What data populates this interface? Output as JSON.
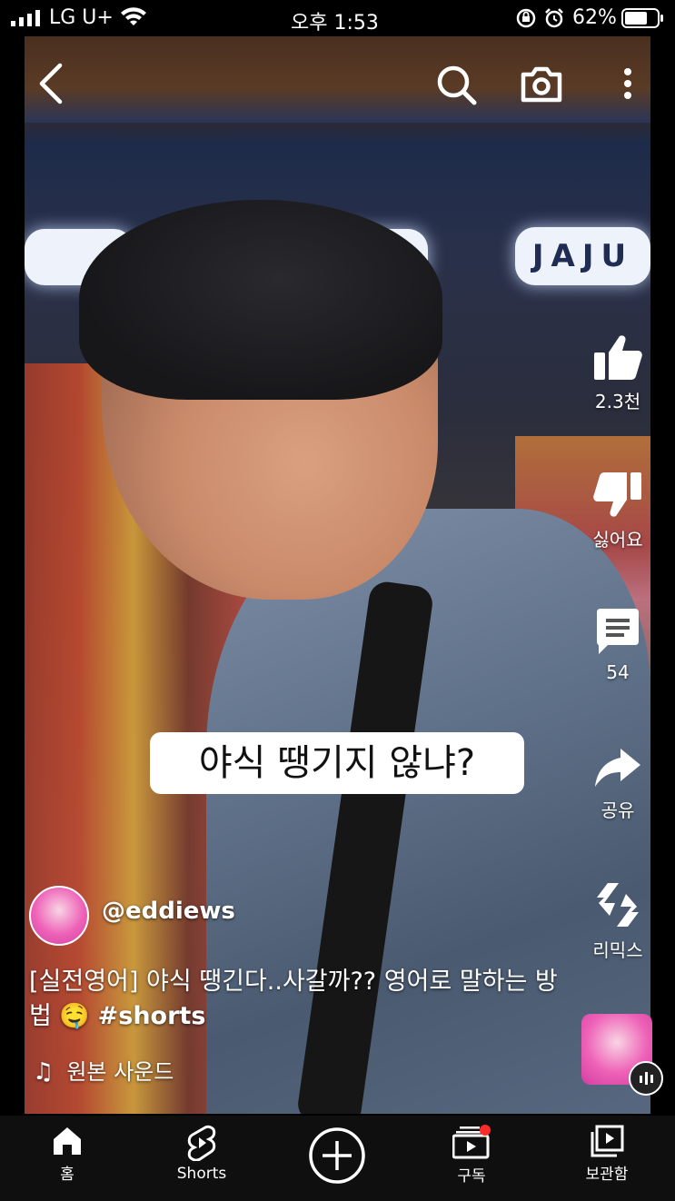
{
  "status_bar": {
    "carrier": "LG U+",
    "time": "오후 1:53",
    "battery": "62%",
    "icons": [
      "signal-icon",
      "wifi-icon",
      "rotation-lock-icon",
      "alarm-icon",
      "battery-icon"
    ]
  },
  "top_bar": {
    "back_icon": "back-arrow-icon",
    "search_icon": "search-icon",
    "camera_icon": "camera-icon",
    "more_icon": "more-vertical-icon"
  },
  "video": {
    "store_sign": "JAJU",
    "caption": "야식 땡기지 않냐?"
  },
  "actions": {
    "like_count": "2.3천",
    "dislike_label": "싫어요",
    "comment_count": "54",
    "share_label": "공유",
    "remix_label": "리믹스"
  },
  "channel": {
    "name": "@eddiews"
  },
  "video_title": {
    "text": "[실전영어] 야식 땡긴다..사갈까?? 영어로 말하는 방법 🤤",
    "hashtag": "#shorts"
  },
  "sound": {
    "label": "원본 사운드"
  },
  "bottom_nav": {
    "home": "홈",
    "shorts": "Shorts",
    "subscriptions": "구독",
    "library": "보관함"
  },
  "colors": {
    "nav_bg": "#0f0f0f",
    "notification_dot": "#ff2a2a",
    "avatar_pink": "#ee62b8"
  }
}
